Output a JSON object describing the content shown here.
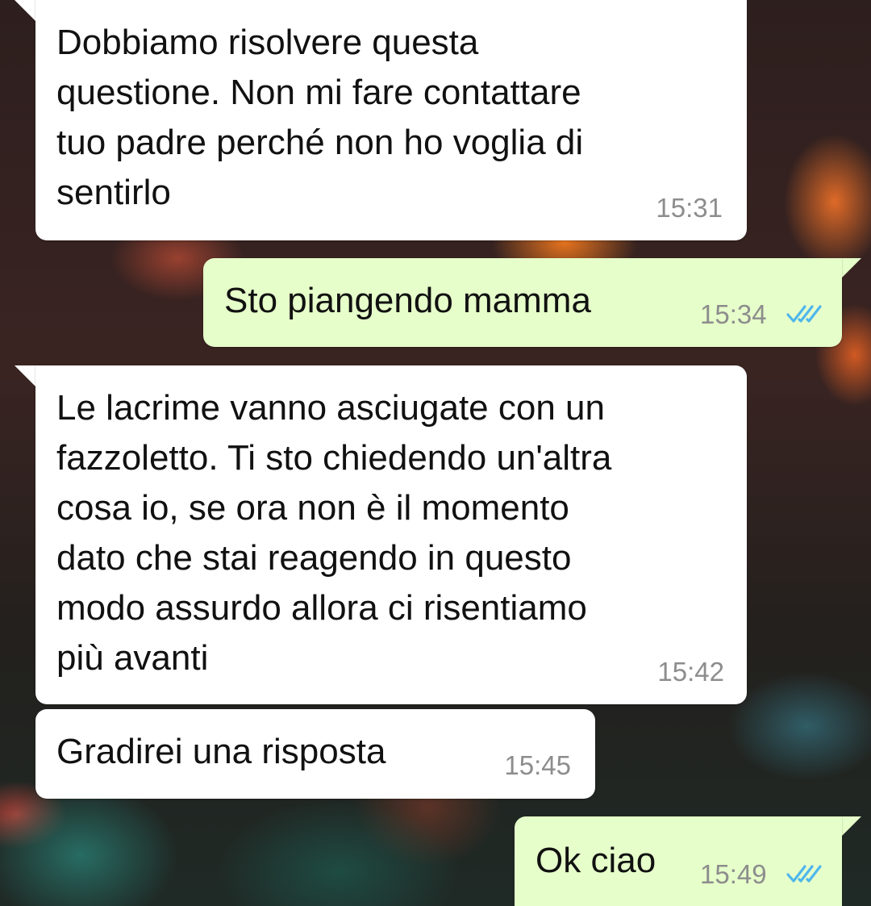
{
  "chat": {
    "messages": [
      {
        "direction": "incoming",
        "lines": [
          "Dobbiamo risolvere questa",
          "questione. Non mi fare contattare",
          "tuo padre perché non ho voglia di",
          "sentirlo"
        ],
        "time": "15:31"
      },
      {
        "direction": "outgoing",
        "lines": [
          "Sto piangendo mamma"
        ],
        "time": "15:34",
        "status": "read-double-check"
      },
      {
        "direction": "incoming",
        "lines": [
          "Le lacrime vanno asciugate con un",
          "fazzoletto. Ti sto chiedendo un'altra",
          "cosa io, se ora non è il momento",
          "dato che stai reagendo in questo",
          "modo assurdo allora ci risentiamo",
          "più avanti"
        ],
        "time": "15:42"
      },
      {
        "direction": "incoming",
        "lines": [
          "Gradirei una risposta"
        ],
        "time": "15:45"
      },
      {
        "direction": "outgoing",
        "lines": [
          "Ok ciao"
        ],
        "time": "15:49",
        "status": "read-double-check"
      }
    ]
  },
  "colors": {
    "incoming_bubble": "#ffffff",
    "outgoing_bubble": "#e6ffca",
    "timestamp": "#8d8d8d",
    "read_ticks": "#4fb6ec"
  }
}
